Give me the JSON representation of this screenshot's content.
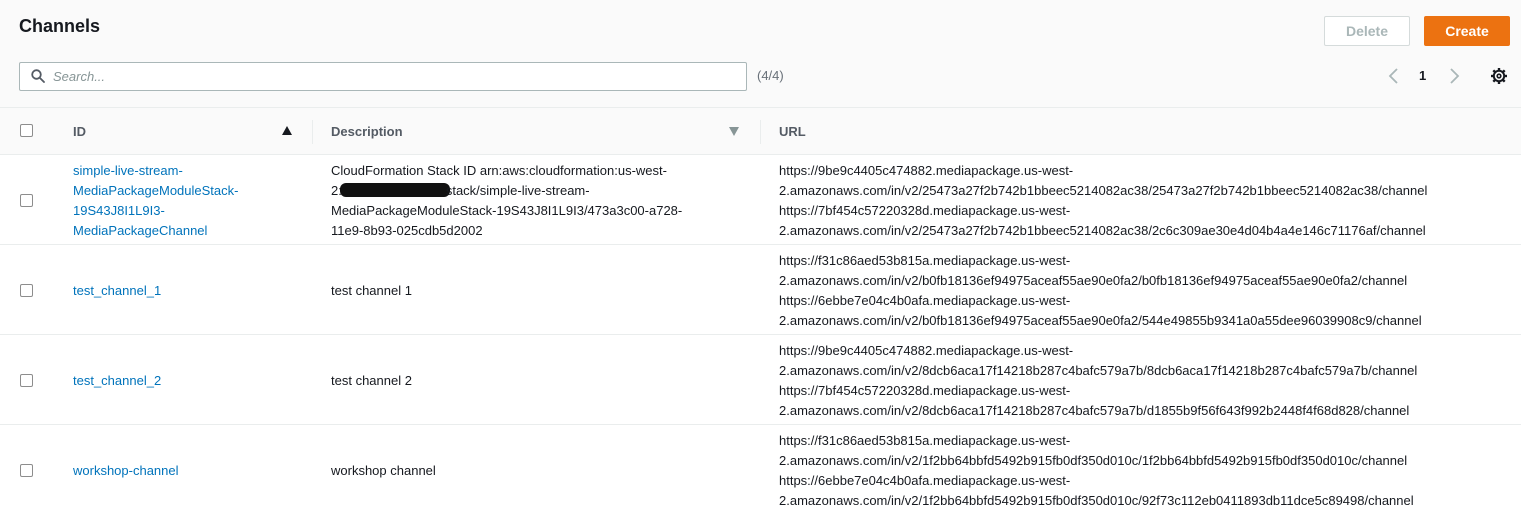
{
  "page": {
    "title": "Channels"
  },
  "toolbar": {
    "delete_label": "Delete",
    "create_label": "Create"
  },
  "search": {
    "placeholder": "Search...",
    "value": "",
    "count": "(4/4)"
  },
  "pagination": {
    "current_page": "1"
  },
  "table": {
    "columns": {
      "id": "ID",
      "description": "Description",
      "url": "URL"
    },
    "rows": [
      {
        "id": "simple-live-stream-MediaPackageModuleStack-19S43J8I1L9I3-MediaPackageChannel",
        "id_lines": [
          "simple-live-stream-",
          "MediaPackageModuleStack-",
          "19S43J8I1L9I3-",
          "MediaPackageChannel"
        ],
        "description_line1": "CloudFormation Stack ID arn:aws:cloudformation:us-west-",
        "description_line2_prefix": "2:",
        "description_line2_suffix": "stack/simple-live-stream-",
        "description_line3": "MediaPackageModuleStack-19S43J8I1L9I3/473a3c00-a728-",
        "description_line4": "11e9-8b93-025cdb5d2002",
        "url_lines": [
          "https://9be9c4405c474882.mediapackage.us-west-",
          "2.amazonaws.com/in/v2/25473a27f2b742b1bbeec5214082ac38/25473a27f2b742b1bbeec5214082ac38/channel",
          "https://7bf454c57220328d.mediapackage.us-west-",
          "2.amazonaws.com/in/v2/25473a27f2b742b1bbeec5214082ac38/2c6c309ae30e4d04b4a4e146c71176af/channel"
        ]
      },
      {
        "id": "test_channel_1",
        "description": "test channel 1",
        "url_lines": [
          "https://f31c86aed53b815a.mediapackage.us-west-",
          "2.amazonaws.com/in/v2/b0fb18136ef94975aceaf55ae90e0fa2/b0fb18136ef94975aceaf55ae90e0fa2/channel",
          "https://6ebbe7e04c4b0afa.mediapackage.us-west-",
          "2.amazonaws.com/in/v2/b0fb18136ef94975aceaf55ae90e0fa2/544e49855b9341a0a55dee96039908c9/channel"
        ]
      },
      {
        "id": "test_channel_2",
        "description": "test channel 2",
        "url_lines": [
          "https://9be9c4405c474882.mediapackage.us-west-",
          "2.amazonaws.com/in/v2/8dcb6aca17f14218b287c4bafc579a7b/8dcb6aca17f14218b287c4bafc579a7b/channel",
          "https://7bf454c57220328d.mediapackage.us-west-",
          "2.amazonaws.com/in/v2/8dcb6aca17f14218b287c4bafc579a7b/d1855b9f56f643f992b2448f4f68d828/channel"
        ]
      },
      {
        "id": "workshop-channel",
        "description": "workshop channel",
        "url_lines": [
          "https://f31c86aed53b815a.mediapackage.us-west-",
          "2.amazonaws.com/in/v2/1f2bb64bbfd5492b915fb0df350d010c/1f2bb64bbfd5492b915fb0df350d010c/channel",
          "https://6ebbe7e04c4b0afa.mediapackage.us-west-",
          "2.amazonaws.com/in/v2/1f2bb64bbfd5492b915fb0df350d010c/92f73c112eb0411893db11dce5c89498/channel"
        ]
      }
    ]
  },
  "colors": {
    "accent": "#ec7211",
    "link": "#0073bb"
  },
  "icons": [
    "search-icon",
    "chevron-left-icon",
    "chevron-right-icon",
    "gear-icon",
    "sort-ascending-icon",
    "sort-descending-icon"
  ]
}
